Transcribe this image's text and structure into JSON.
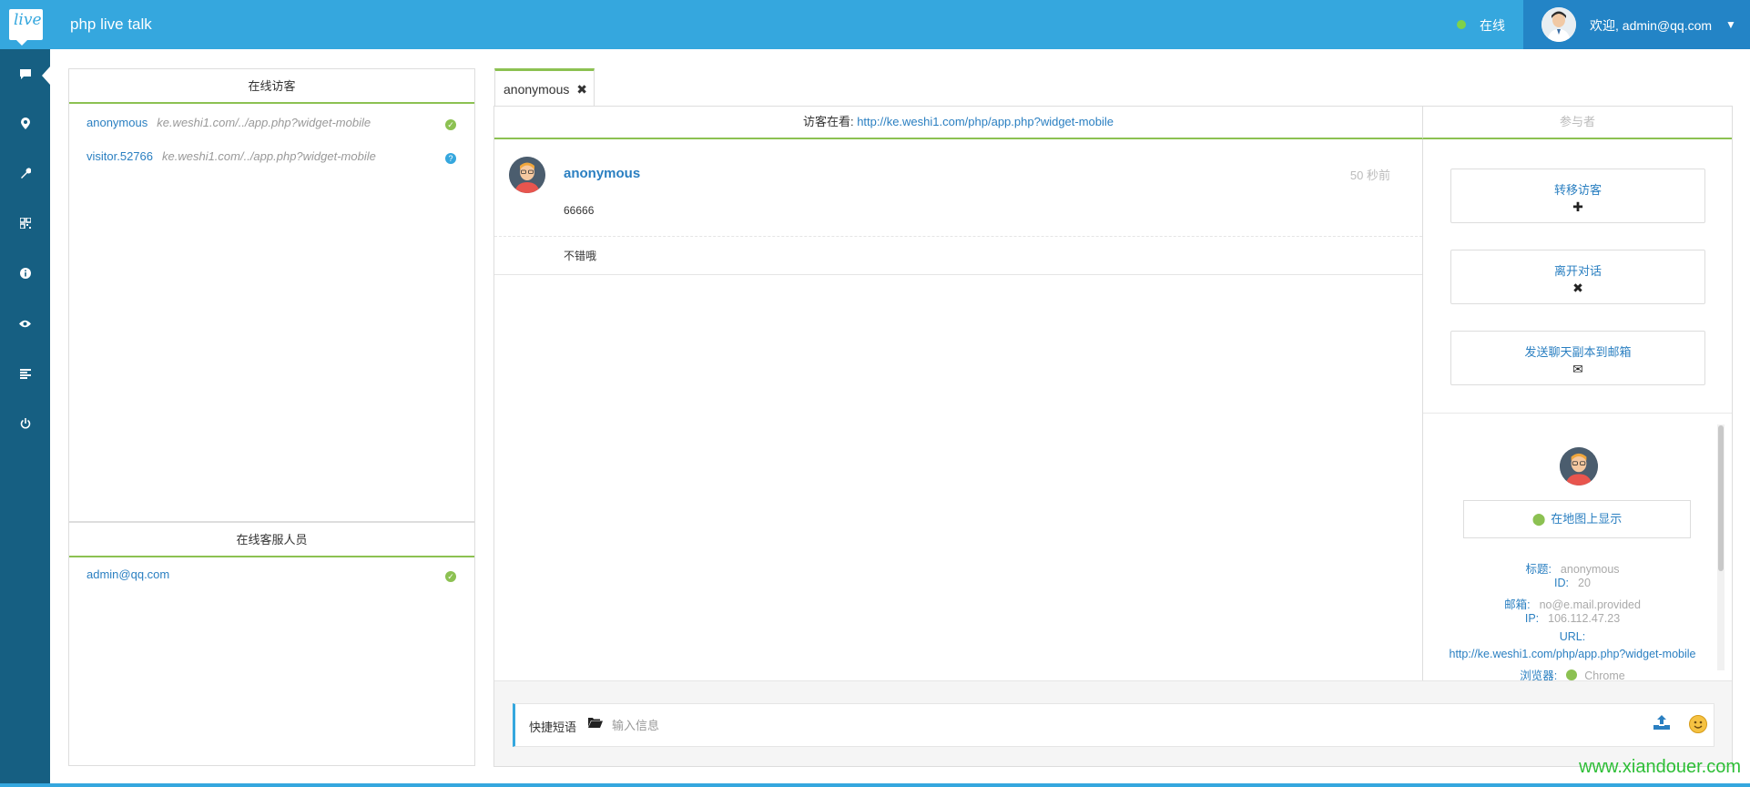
{
  "header": {
    "logo_text": "live",
    "app_title": "php live talk",
    "status_text": "在线",
    "welcome_text": "欢迎, admin@qq.com",
    "status_color": "#7fd24b",
    "bar_color": "#35a7de",
    "user_area_color": "#2384c6"
  },
  "sidebar": {
    "items": [
      {
        "icon": "chat-icon",
        "glyph": "▬"
      },
      {
        "icon": "map-marker-icon",
        "glyph": "⬤"
      },
      {
        "icon": "wrench-icon",
        "glyph": "✎"
      },
      {
        "icon": "qrcode-icon",
        "glyph": "▦"
      },
      {
        "icon": "info-icon",
        "glyph": "ℹ"
      },
      {
        "icon": "eye-icon",
        "glyph": "◉"
      },
      {
        "icon": "list-icon",
        "glyph": "≡"
      },
      {
        "icon": "power-icon",
        "glyph": "⏻"
      }
    ]
  },
  "visitors_panel": {
    "title": "在线访客",
    "items": [
      {
        "name": "anonymous",
        "url": "ke.weshi1.com/../app.php?widget-mobile",
        "status": "online"
      },
      {
        "name": "visitor.52766",
        "url": "ke.weshi1.com/../app.php?widget-mobile",
        "status": "unknown"
      }
    ]
  },
  "staff_panel": {
    "title": "在线客服人员",
    "items": [
      {
        "name": "admin@qq.com",
        "status": "online"
      }
    ]
  },
  "chat": {
    "tab_label": "anonymous",
    "watching_label": "访客在看: ",
    "watching_url": "http://ke.weshi1.com/php/app.php?widget-mobile",
    "participants_label": "参与者",
    "message": {
      "author": "anonymous",
      "time": "50 秒前",
      "line1": "66666",
      "line2": "不错哦"
    },
    "actions": [
      {
        "label": "转移访客",
        "icon": "plus-icon",
        "glyph": "✚"
      },
      {
        "label": "离开对话",
        "icon": "close-icon",
        "glyph": "✖"
      },
      {
        "label": "发送聊天副本到邮箱",
        "icon": "envelope-icon",
        "glyph": "✉"
      }
    ],
    "map_button": "在地图上显示",
    "info": {
      "title_label": "标题:",
      "title_value": "anonymous",
      "id_label": "ID:",
      "id_value": "20",
      "email_label": "邮箱:",
      "email_value": "no@e.mail.provided",
      "ip_label": "IP:",
      "ip_value": "106.112.47.23",
      "url_label": "URL:",
      "url_value": "http://ke.weshi1.com/php/app.php?widget-mobile",
      "browser_label": "浏览器:",
      "browser_value": "Chrome"
    },
    "input": {
      "quick_label": "快捷短语",
      "placeholder": "输入信息"
    }
  },
  "watermark": "www.xiandouer.com"
}
